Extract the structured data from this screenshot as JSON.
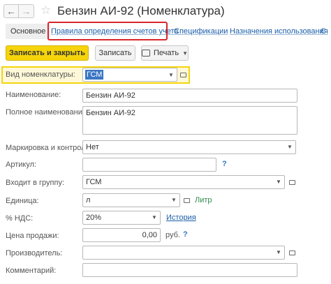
{
  "header": {
    "title": "Бензин АИ-92 (Номенклатура)",
    "back_icon": "arrow-left-icon",
    "forward_icon": "arrow-right-icon",
    "favorite_icon": "star-icon"
  },
  "tabs": [
    {
      "label": "Основное",
      "active": true
    },
    {
      "label": "Правила определения счетов учета",
      "active": false
    },
    {
      "label": "Спецификации",
      "active": false
    },
    {
      "label": "Назначения использования",
      "active": false
    },
    {
      "label": "С",
      "active": false
    }
  ],
  "toolbar": {
    "save_close_label": "Записать и закрыть",
    "save_label": "Записать",
    "print_label": "Печать"
  },
  "form": {
    "kind": {
      "label": "Вид номенклатуры:",
      "value": "ГСМ"
    },
    "name": {
      "label": "Наименование:",
      "value": "Бензин АИ-92"
    },
    "full_name": {
      "label": "Полное наименование:",
      "value": "Бензин АИ-92"
    },
    "marking": {
      "label": "Маркировка и контроль:",
      "value": "Нет"
    },
    "article": {
      "label": "Артикул:",
      "value": "",
      "help": "?"
    },
    "group": {
      "label": "Входит в группу:",
      "value": "ГСМ"
    },
    "unit": {
      "label": "Единица:",
      "value": "л",
      "hint": "Литр"
    },
    "vat": {
      "label": "% НДС:",
      "value": "20%",
      "history_link": "История"
    },
    "price": {
      "label": "Цена продажи:",
      "value": "0,00",
      "currency": "руб.",
      "help": "?"
    },
    "manufacturer": {
      "label": "Производитель:",
      "value": ""
    },
    "comment": {
      "label": "Комментарий:",
      "value": ""
    }
  },
  "colors": {
    "accent_yellow": "#f5d40b",
    "link_blue": "#1a5ea8",
    "highlight_red": "#d9262a"
  }
}
